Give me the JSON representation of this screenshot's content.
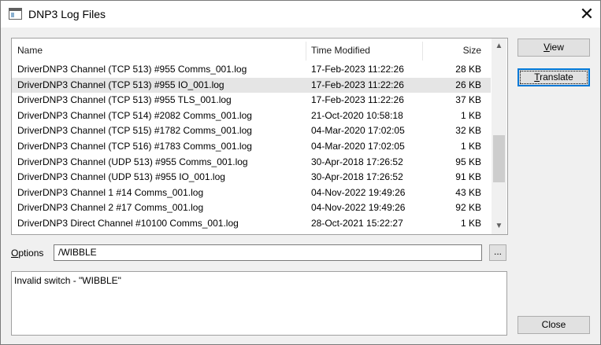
{
  "window": {
    "title": "DNP3 Log Files",
    "close_glyph": "✕"
  },
  "list": {
    "columns": {
      "name": "Name",
      "time": "Time Modified",
      "size": "Size"
    },
    "rows": [
      {
        "name": "DriverDNP3 Channel (TCP 513) #955 Comms_001.log",
        "time": "17-Feb-2023 11:22:26",
        "size": "28 KB"
      },
      {
        "name": "DriverDNP3 Channel (TCP 513) #955 IO_001.log",
        "time": "17-Feb-2023 11:22:26",
        "size": "26 KB"
      },
      {
        "name": "DriverDNP3 Channel (TCP 513) #955 TLS_001.log",
        "time": "17-Feb-2023 11:22:26",
        "size": "37 KB"
      },
      {
        "name": "DriverDNP3 Channel (TCP 514) #2082 Comms_001.log",
        "time": "21-Oct-2020 10:58:18",
        "size": "1 KB"
      },
      {
        "name": "DriverDNP3 Channel (TCP 515) #1782 Comms_001.log",
        "time": "04-Mar-2020 17:02:05",
        "size": "32 KB"
      },
      {
        "name": "DriverDNP3 Channel (TCP 516) #1783 Comms_001.log",
        "time": "04-Mar-2020 17:02:05",
        "size": "1 KB"
      },
      {
        "name": "DriverDNP3 Channel (UDP 513) #955 Comms_001.log",
        "time": "30-Apr-2018 17:26:52",
        "size": "95 KB"
      },
      {
        "name": "DriverDNP3 Channel (UDP 513) #955 IO_001.log",
        "time": "30-Apr-2018 17:26:52",
        "size": "91 KB"
      },
      {
        "name": "DriverDNP3 Channel 1 #14 Comms_001.log",
        "time": "04-Nov-2022 19:49:26",
        "size": "43 KB"
      },
      {
        "name": "DriverDNP3 Channel 2 #17 Comms_001.log",
        "time": "04-Nov-2022 19:49:26",
        "size": "92 KB"
      },
      {
        "name": "DriverDNP3 Direct Channel #10100 Comms_001.log",
        "time": "28-Oct-2021 15:22:27",
        "size": "1 KB"
      }
    ],
    "selected_index": 1,
    "scroll_up_glyph": "▲",
    "scroll_down_glyph": "▼"
  },
  "options": {
    "label_first": "O",
    "label_rest": "ptions",
    "value": "/WIBBLE",
    "browse_label": "..."
  },
  "output": {
    "text": "Invalid switch - \"WIBBLE\""
  },
  "buttons": {
    "view_first": "V",
    "view_rest": "iew",
    "translate_first": "T",
    "translate_rest": "ranslate",
    "close": "Close"
  }
}
